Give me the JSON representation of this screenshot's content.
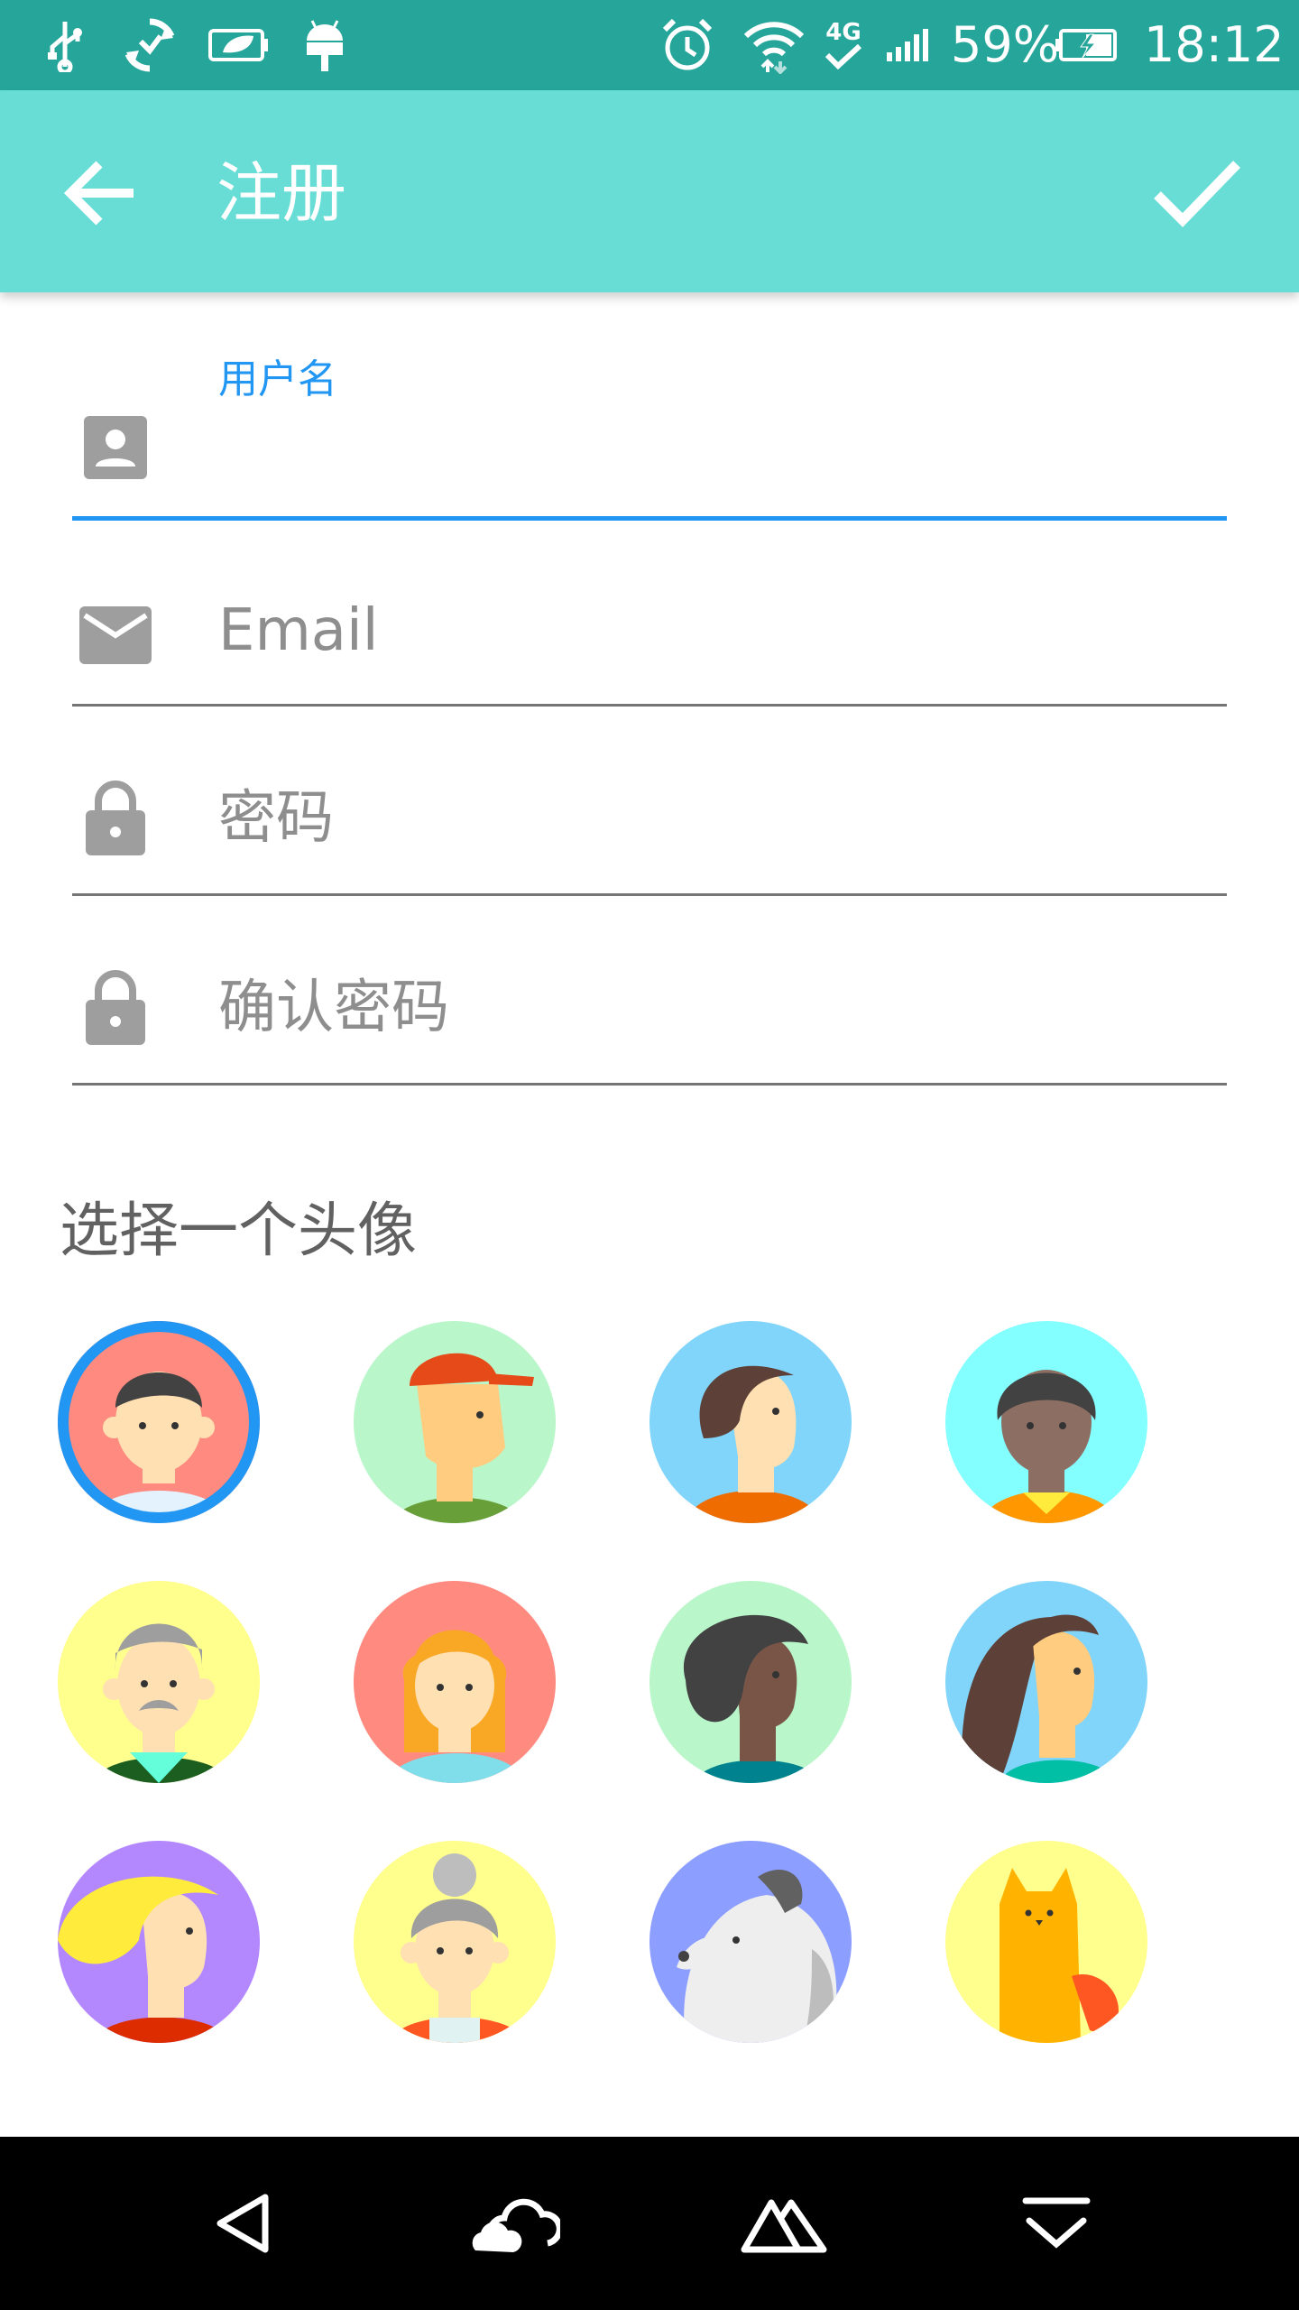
{
  "status_bar": {
    "battery_percent": "59%",
    "time": "18:12",
    "network_label": "4G",
    "icons": [
      "usb-icon",
      "sync-icon",
      "leaf-battery-icon",
      "android-debug-icon",
      "alarm-icon",
      "wifi-icon",
      "network-4g-icon",
      "signal-icon",
      "battery-charging-icon"
    ]
  },
  "app_bar": {
    "title": "注册",
    "back_icon": "arrow-back-icon",
    "confirm_icon": "check-icon",
    "background": "#68ddd5"
  },
  "form": {
    "username": {
      "label": "用户名",
      "value": "",
      "icon": "account-box-icon"
    },
    "email": {
      "placeholder": "Email",
      "value": "",
      "icon": "mail-icon"
    },
    "password": {
      "placeholder": "密码",
      "value": "",
      "icon": "lock-icon"
    },
    "confirm_password": {
      "placeholder": "确认密码",
      "value": "",
      "icon": "lock-icon"
    }
  },
  "avatar_section": {
    "heading": "选择一个头像",
    "selected_index": 0,
    "avatars": [
      {
        "name": "avatar-boy",
        "bg": "#ff8a80"
      },
      {
        "name": "avatar-cap-boy",
        "bg": "#b9f6ca"
      },
      {
        "name": "avatar-girl-brown-hair",
        "bg": "#81d4fa"
      },
      {
        "name": "avatar-dark-skin-boy",
        "bg": "#84ffff"
      },
      {
        "name": "avatar-old-man-mustache",
        "bg": "#ffff8d"
      },
      {
        "name": "avatar-blonde-girl",
        "bg": "#ff8a80"
      },
      {
        "name": "avatar-dark-skin-girl",
        "bg": "#b9f6ca"
      },
      {
        "name": "avatar-long-hair-woman",
        "bg": "#81d4fa"
      },
      {
        "name": "avatar-blonde-woman",
        "bg": "#b388ff"
      },
      {
        "name": "avatar-grandma",
        "bg": "#ffff8d"
      },
      {
        "name": "avatar-dog",
        "bg": "#8c9eff"
      },
      {
        "name": "avatar-cat",
        "bg": "#ffff8d"
      }
    ]
  },
  "nav_bar": {
    "icons": [
      "back-triangle-icon",
      "cloud-home-icon",
      "mountain-recents-icon",
      "collapse-down-icon"
    ]
  },
  "colors": {
    "accent": "#2196f3",
    "status_bar": "#26a69a",
    "icon_gray": "#9e9e9e"
  }
}
